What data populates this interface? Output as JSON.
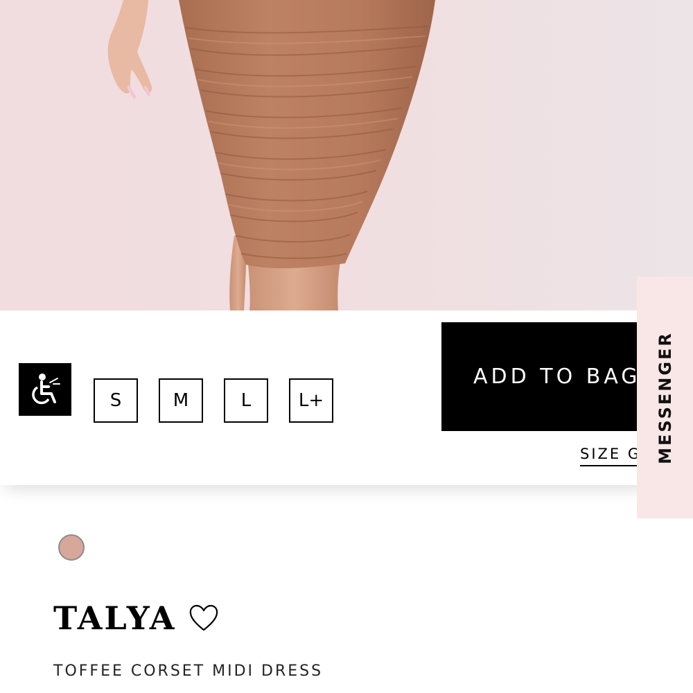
{
  "hero": {
    "image_alt": "Model wearing toffee ruched corset midi dress"
  },
  "accessibility": {
    "icon": "wheelchair-icon"
  },
  "sizes": {
    "options": [
      "S",
      "M",
      "L",
      "L+"
    ]
  },
  "actions": {
    "add_to_bag_label": "ADD TO BAG",
    "size_guide_label": "SIZE GUIDE"
  },
  "messenger": {
    "label": "MESSENGER"
  },
  "product": {
    "swatch_color": "#d7a79a",
    "brand": "TALYA",
    "wishlist_icon": "heart-icon",
    "title": "TOFFEE CORSET MIDI DRESS"
  },
  "colors": {
    "background_photo": "#f0dcde",
    "dress": "#b57a5d",
    "button_bg": "#000000",
    "messenger_bg": "#f8e7e6"
  }
}
